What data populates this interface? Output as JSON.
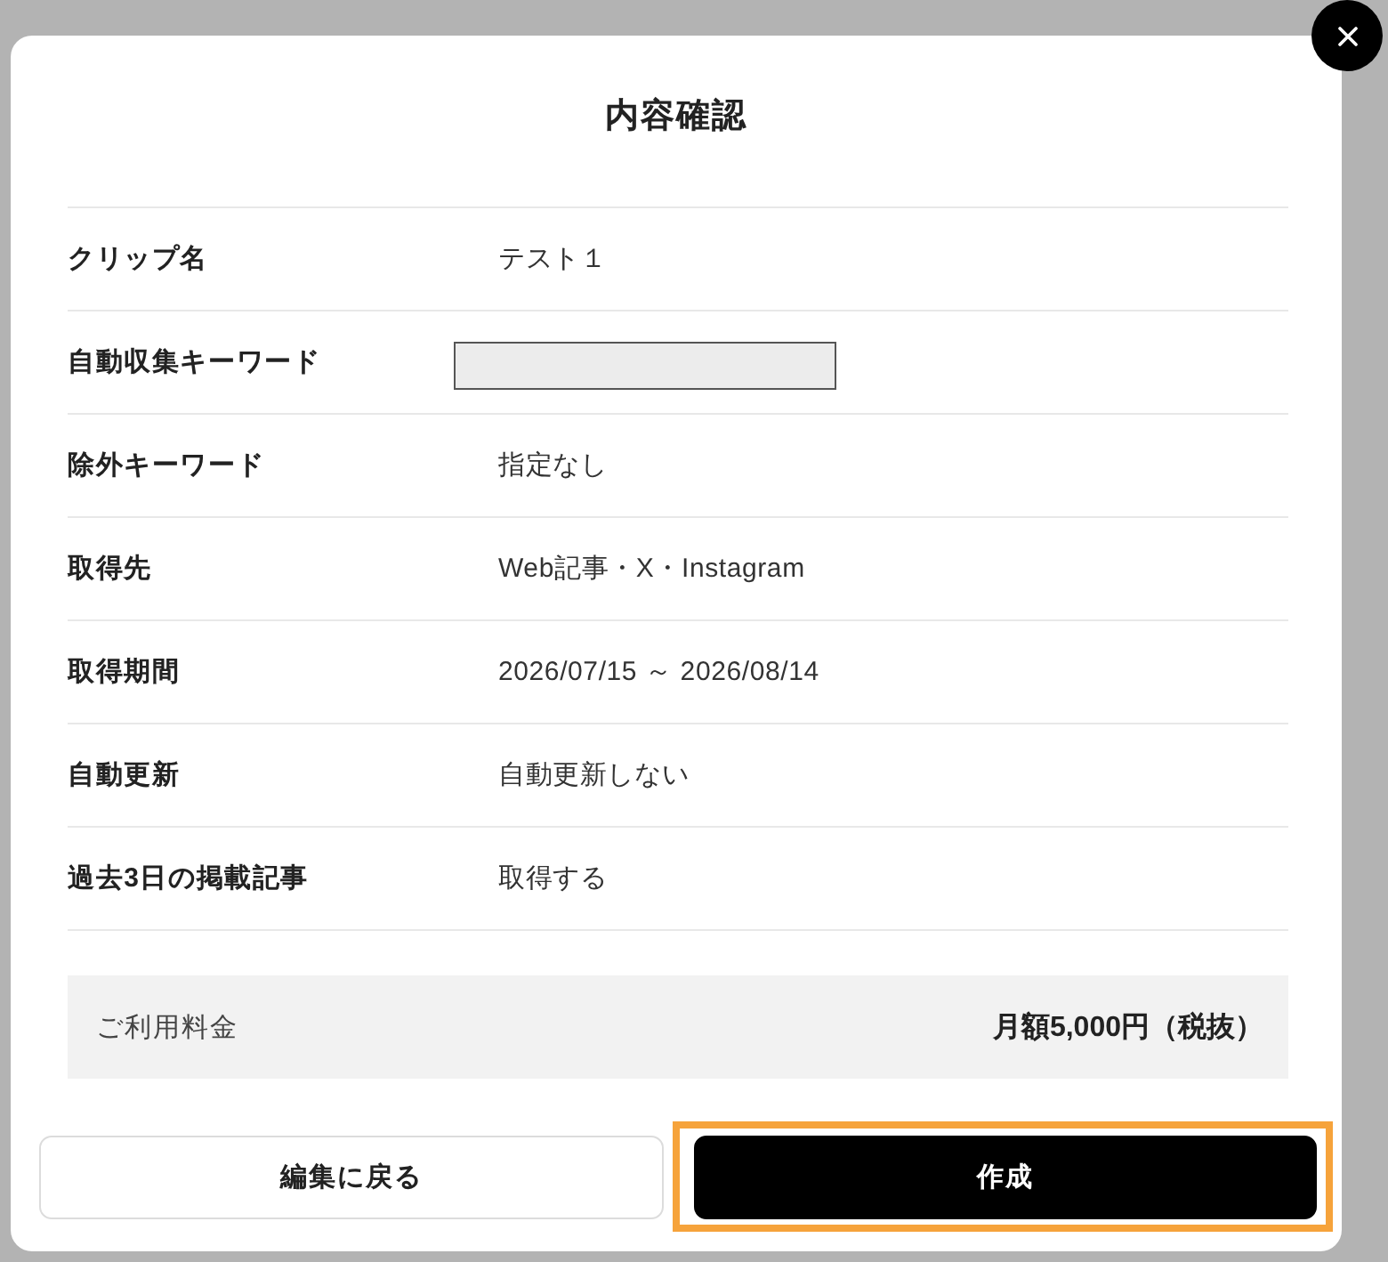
{
  "dialog": {
    "title": "内容確認"
  },
  "rows": [
    {
      "label": "クリップ名",
      "kind": "text",
      "value": "テスト１"
    },
    {
      "label": "自動収集キーワード",
      "kind": "redacted"
    },
    {
      "label": "除外キーワード",
      "kind": "text",
      "value": "指定なし"
    },
    {
      "label": "取得先",
      "kind": "text",
      "value": "Web記事・X・Instagram"
    },
    {
      "label": "取得期間",
      "kind": "text",
      "value": "2026/07/15 ～ 2026/08/14"
    },
    {
      "label": "自動更新",
      "kind": "text",
      "value": "自動更新しない"
    },
    {
      "label": "過去3日の掲載記事",
      "kind": "text",
      "value": "取得する"
    }
  ],
  "fee": {
    "label": "ご利用料金",
    "value": "月額5,000円（税抜）"
  },
  "buttons": [
    {
      "label": "編集に戻る",
      "kind": "secondary",
      "highlighted": false
    },
    {
      "label": "作成",
      "kind": "primary",
      "highlighted": true
    }
  ]
}
